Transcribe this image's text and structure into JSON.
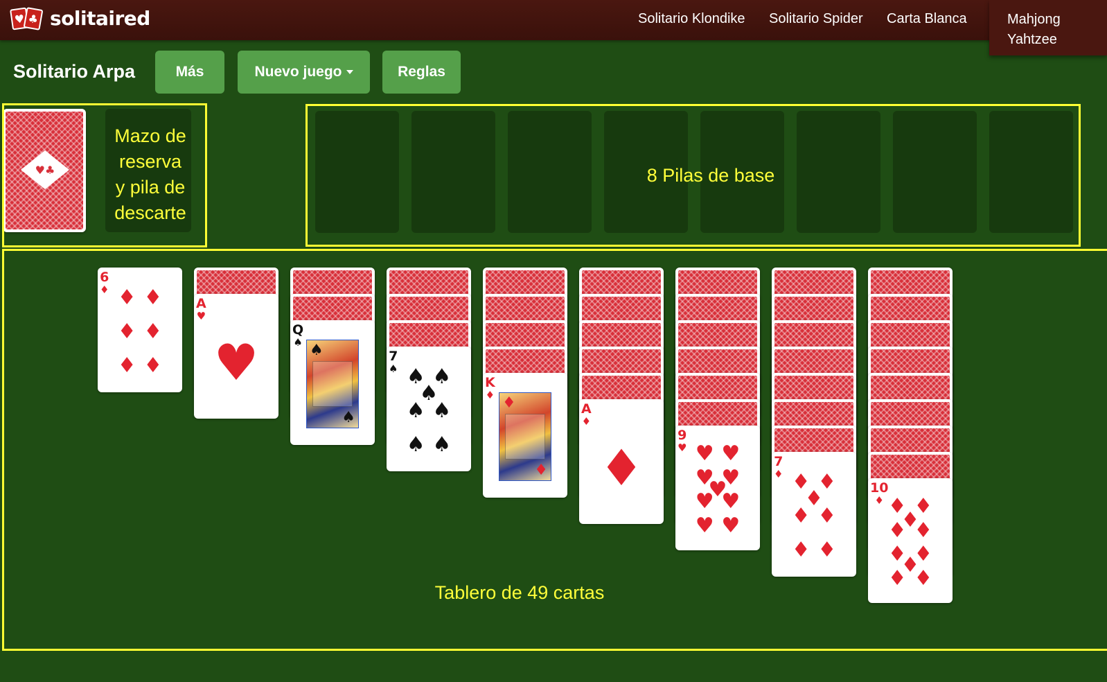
{
  "brand": {
    "name": "solitaired",
    "logo_suits": [
      "♥",
      "♣"
    ],
    "color": "#c8221c"
  },
  "nav": {
    "items": [
      "Solitario Klondike",
      "Solitario Spider",
      "Carta Blanca",
      "Mahjong"
    ],
    "dropdown_item": "Yahtzee"
  },
  "toolbar": {
    "title": "Solitario Arpa",
    "more_label": "Más",
    "new_game_label": "Nuevo juego",
    "rules_label": "Reglas"
  },
  "labels": {
    "stock_lines": [
      "Mazo de",
      "reserva",
      "y pila de",
      "descarte"
    ],
    "foundations": "8 Pilas de base",
    "tableau": "Tablero de 49 cartas"
  },
  "foundation_count": 8,
  "tableau": [
    {
      "down": 0,
      "up": {
        "rank": "6",
        "suit": "♦",
        "color": "red"
      }
    },
    {
      "down": 1,
      "up": {
        "rank": "A",
        "suit": "♥",
        "color": "red"
      }
    },
    {
      "down": 2,
      "up": {
        "rank": "Q",
        "suit": "♠",
        "color": "black"
      }
    },
    {
      "down": 3,
      "up": {
        "rank": "7",
        "suit": "♠",
        "color": "black"
      }
    },
    {
      "down": 4,
      "up": {
        "rank": "K",
        "suit": "♦",
        "color": "red"
      }
    },
    {
      "down": 5,
      "up": {
        "rank": "A",
        "suit": "♦",
        "color": "red"
      }
    },
    {
      "down": 6,
      "up": {
        "rank": "9",
        "suit": "♥",
        "color": "red"
      }
    },
    {
      "down": 7,
      "up": {
        "rank": "7",
        "suit": "♦",
        "color": "red"
      }
    },
    {
      "down": 8,
      "up": {
        "rank": "10",
        "suit": "♦",
        "color": "red"
      }
    }
  ],
  "colors": {
    "felt": "#1f4d14",
    "highlight": "#ffff33",
    "button": "#55a04a",
    "card_red": "#e3232f",
    "card_back": "#d8303a"
  }
}
